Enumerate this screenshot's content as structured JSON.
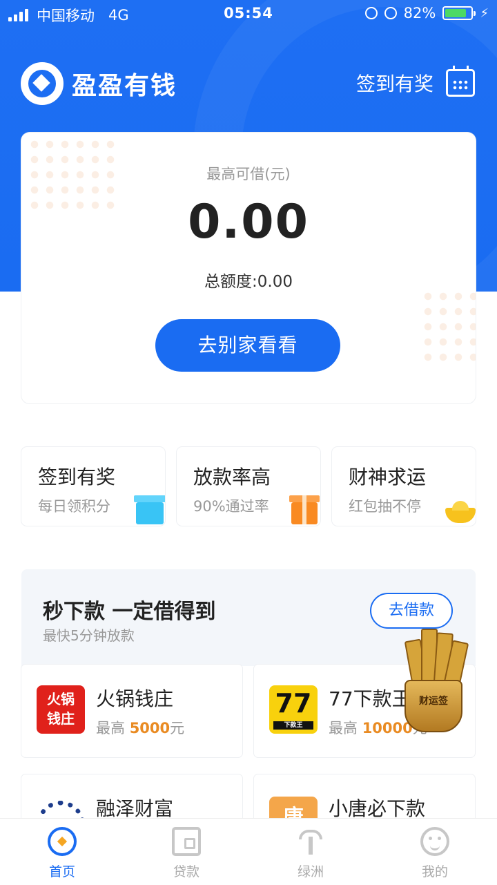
{
  "status_bar": {
    "carrier": "中国移动",
    "network": "4G",
    "time": "05:54",
    "battery_percent": "82%",
    "battery_level": 0.82
  },
  "header": {
    "app_name": "盈盈有钱",
    "checkin_label": "签到有奖"
  },
  "credit_card": {
    "max_label": "最高可借(元)",
    "max_amount": "0.00",
    "total_label": "总额度:0.00",
    "cta_label": "去别家看看"
  },
  "features": [
    {
      "title": "签到有奖",
      "subtitle": "每日领积分",
      "icon": "gift-icon",
      "color": "#39c4f5"
    },
    {
      "title": "放款率高",
      "subtitle": "90%通过率",
      "icon": "gift-icon",
      "color": "#f98a22"
    },
    {
      "title": "财神求运",
      "subtitle": "红包抽不停",
      "icon": "gold-ingot-icon",
      "color": "#f7c21d"
    }
  ],
  "promo": {
    "title": "秒下款 一定借得到",
    "subtitle": "最快5分钟放款",
    "button_label": "去借款",
    "decoration_text": "财运签"
  },
  "products": [
    {
      "name": "火锅钱庄",
      "prefix": "最高 ",
      "amount": "5000",
      "unit": "元",
      "logo_text": "火锅钱庄"
    },
    {
      "name": "77下款王",
      "prefix": "最高 ",
      "amount": "10000",
      "unit": "元",
      "logo_text": "77",
      "logo_sub": "下款王"
    },
    {
      "name": "融泽财富"
    },
    {
      "name": "小唐必下款",
      "logo_text": "唐"
    }
  ],
  "tabs": [
    {
      "label": "首页",
      "active": true,
      "icon": "home-icon"
    },
    {
      "label": "贷款",
      "active": false,
      "icon": "wallet-icon"
    },
    {
      "label": "绿洲",
      "active": false,
      "icon": "palm-tree-icon"
    },
    {
      "label": "我的",
      "active": false,
      "icon": "profile-icon"
    }
  ],
  "colors": {
    "primary": "#1a6cf2",
    "accent": "#e98b23"
  }
}
